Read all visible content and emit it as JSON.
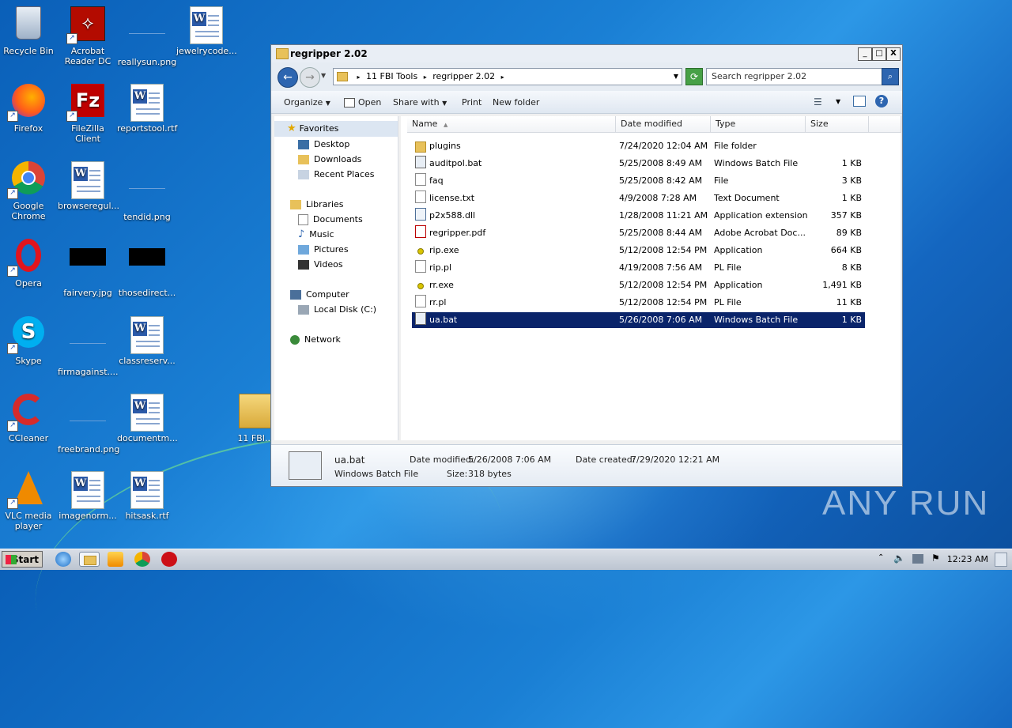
{
  "desktop": {
    "icons": [
      {
        "label": "Recycle Bin"
      },
      {
        "label": "Acrobat Reader DC"
      },
      {
        "label": "reallysun.png"
      },
      {
        "label": "jewelrycode..."
      },
      {
        "label": "Firefox"
      },
      {
        "label": "FileZilla Client"
      },
      {
        "label": "reportstool.rtf"
      },
      {
        "label": "Google Chrome"
      },
      {
        "label": "browseregul..."
      },
      {
        "label": "tendid.png"
      },
      {
        "label": "Opera"
      },
      {
        "label": "fairvery.jpg"
      },
      {
        "label": "thosedirect..."
      },
      {
        "label": "Skype"
      },
      {
        "label": "firmagainst...."
      },
      {
        "label": "classreserv..."
      },
      {
        "label": "CCleaner"
      },
      {
        "label": "freebrand.png"
      },
      {
        "label": "documentm..."
      },
      {
        "label": "VLC media player"
      },
      {
        "label": "imagenorm..."
      },
      {
        "label": "hitsask.rtf"
      },
      {
        "label": "11 FBI..."
      }
    ]
  },
  "window": {
    "title": "regripper 2.02",
    "controls": {
      "minimize": "_",
      "maximize": "□",
      "close": "X"
    },
    "address": {
      "crumb1": "11 FBI Tools",
      "crumb2": "regripper 2.02"
    },
    "search_placeholder": "Search regripper 2.02",
    "toolbar": {
      "organize": "Organize",
      "open": "Open",
      "share_with": "Share with",
      "print": "Print",
      "new_folder": "New folder"
    },
    "nav": {
      "favorites": "Favorites",
      "desktop": "Desktop",
      "downloads": "Downloads",
      "recent_places": "Recent Places",
      "libraries": "Libraries",
      "documents": "Documents",
      "music": "Music",
      "pictures": "Pictures",
      "videos": "Videos",
      "computer": "Computer",
      "local_disk": "Local Disk (C:)",
      "network": "Network"
    },
    "columns": {
      "name": "Name",
      "date": "Date modified",
      "type": "Type",
      "size": "Size"
    },
    "files": [
      {
        "name": "plugins",
        "date": "7/24/2020 12:04 AM",
        "type": "File folder",
        "size": "",
        "icon": "folder-icon"
      },
      {
        "name": "auditpol.bat",
        "date": "5/25/2008 8:49 AM",
        "type": "Windows Batch File",
        "size": "1 KB",
        "icon": "batch-file-icon"
      },
      {
        "name": "faq",
        "date": "5/25/2008 8:42 AM",
        "type": "File",
        "size": "3 KB",
        "icon": "file-icon"
      },
      {
        "name": "license.txt",
        "date": "4/9/2008 7:28 AM",
        "type": "Text Document",
        "size": "1 KB",
        "icon": "text-file-icon"
      },
      {
        "name": "p2x588.dll",
        "date": "1/28/2008 11:21 AM",
        "type": "Application extension",
        "size": "357 KB",
        "icon": "dll-icon"
      },
      {
        "name": "regripper.pdf",
        "date": "5/25/2008 8:44 AM",
        "type": "Adobe Acrobat Doc...",
        "size": "89 KB",
        "icon": "pdf-icon"
      },
      {
        "name": "rip.exe",
        "date": "5/12/2008 12:54 PM",
        "type": "Application",
        "size": "664 KB",
        "icon": "exe-icon"
      },
      {
        "name": "rip.pl",
        "date": "4/19/2008 7:56 AM",
        "type": "PL File",
        "size": "8 KB",
        "icon": "file-icon"
      },
      {
        "name": "rr.exe",
        "date": "5/12/2008 12:54 PM",
        "type": "Application",
        "size": "1,491 KB",
        "icon": "exe-icon"
      },
      {
        "name": "rr.pl",
        "date": "5/12/2008 12:54 PM",
        "type": "PL File",
        "size": "11 KB",
        "icon": "file-icon"
      },
      {
        "name": "ua.bat",
        "date": "5/26/2008 7:06 AM",
        "type": "Windows Batch File",
        "size": "1 KB",
        "icon": "batch-file-icon",
        "selected": true
      }
    ],
    "details": {
      "name": "ua.bat",
      "type": "Windows Batch File",
      "date_modified_label": "Date modified:",
      "date_modified": "5/26/2008 7:06 AM",
      "date_created_label": "Date created:",
      "date_created": "7/29/2020 12:21 AM",
      "size_label": "Size:",
      "size": "318 bytes"
    }
  },
  "taskbar": {
    "start": "Start",
    "clock": "12:23 AM"
  },
  "watermark": "ANY RUN"
}
